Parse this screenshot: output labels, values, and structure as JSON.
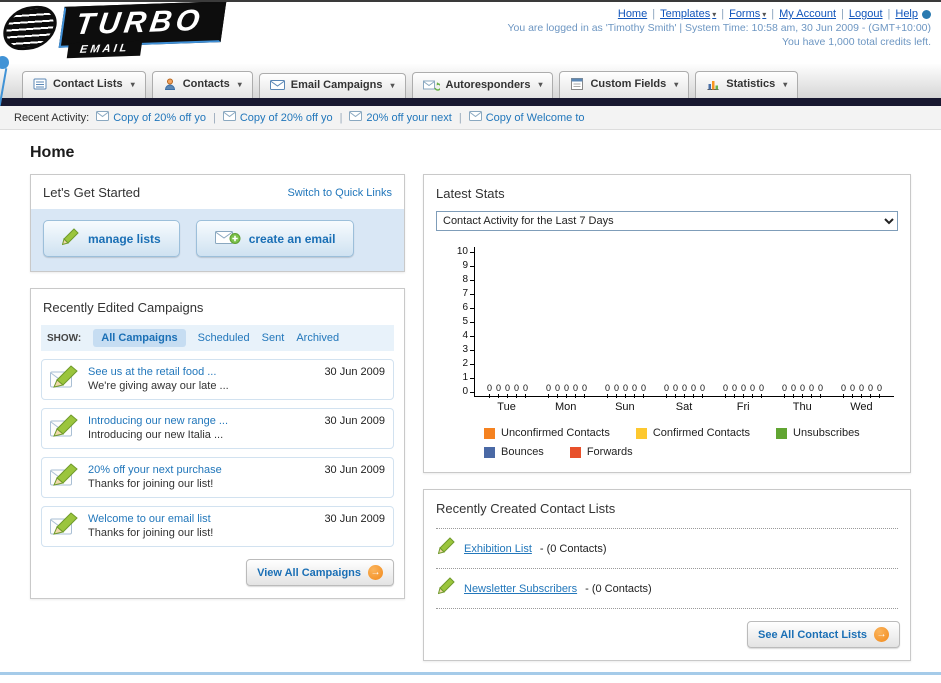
{
  "header": {
    "logo": {
      "title": "TURBO",
      "subtitle": "EMAIL"
    },
    "links": [
      "Home",
      "Templates",
      "Forms",
      "My Account",
      "Logout",
      "Help"
    ],
    "login_info": "You are logged in as 'Timothy Smith' | System Time: 10:58 am, 30 Jun 2009 - (GMT+10:00)",
    "credits": "You have 1,000 total credits left."
  },
  "nav": {
    "tabs": [
      {
        "label": "Contact Lists"
      },
      {
        "label": "Contacts"
      },
      {
        "label": "Email Campaigns"
      },
      {
        "label": "Autoresponders"
      },
      {
        "label": "Custom Fields"
      },
      {
        "label": "Statistics"
      }
    ]
  },
  "recent_activity": {
    "label": "Recent Activity:",
    "items": [
      {
        "label": "Copy of 20% off yo"
      },
      {
        "label": "Copy of 20% off yo"
      },
      {
        "label": "20% off your next"
      },
      {
        "label": "Copy of Welcome to"
      }
    ]
  },
  "page": {
    "title": "Home"
  },
  "get_started": {
    "title": "Let's Get Started",
    "switch_link": "Switch to Quick Links",
    "manage_lists_label": "manage lists",
    "create_email_label": "create an email"
  },
  "campaigns": {
    "title": "Recently Edited Campaigns",
    "show_label": "SHOW:",
    "filters": [
      {
        "label": "All Campaigns",
        "active": true
      },
      {
        "label": "Scheduled",
        "active": false
      },
      {
        "label": "Sent",
        "active": false
      },
      {
        "label": "Archived",
        "active": false
      }
    ],
    "items": [
      {
        "title": "See us at the retail food ...",
        "subtitle": "We're giving away our late ...",
        "date": "30 Jun 2009"
      },
      {
        "title": "Introducing our new range ...",
        "subtitle": "Introducing our new Italia ...",
        "date": "30 Jun 2009"
      },
      {
        "title": "20% off your next purchase",
        "subtitle": "Thanks for joining our list!",
        "date": "30 Jun 2009"
      },
      {
        "title": "Welcome to our email list",
        "subtitle": "Thanks for joining our list!",
        "date": "30 Jun 2009"
      }
    ],
    "view_all_label": "View All Campaigns"
  },
  "stats": {
    "title": "Latest Stats",
    "selected_option": "Contact Activity for the Last 7 Days",
    "chart_data": {
      "type": "bar",
      "title": "Contact Activity for the Last 7 Days",
      "categories": [
        "Tue",
        "Mon",
        "Sun",
        "Sat",
        "Fri",
        "Thu",
        "Wed"
      ],
      "series": [
        {
          "name": "Unconfirmed Contacts",
          "values": [
            0,
            0,
            0,
            0,
            0,
            0,
            0
          ]
        },
        {
          "name": "Confirmed Contacts",
          "values": [
            0,
            0,
            0,
            0,
            0,
            0,
            0
          ]
        },
        {
          "name": "Unsubscribes",
          "values": [
            0,
            0,
            0,
            0,
            0,
            0,
            0
          ]
        },
        {
          "name": "Bounces",
          "values": [
            0,
            0,
            0,
            0,
            0,
            0,
            0
          ]
        },
        {
          "name": "Forwards",
          "values": [
            0,
            0,
            0,
            0,
            0,
            0,
            0
          ]
        }
      ],
      "ylim": [
        0,
        10
      ],
      "grid": false,
      "legend_position": "bottom"
    },
    "legend": [
      {
        "label": "Unconfirmed Contacts",
        "color": "#f58220"
      },
      {
        "label": "Confirmed Contacts",
        "color": "#fdc82f"
      },
      {
        "label": "Unsubscribes",
        "color": "#61a532"
      },
      {
        "label": "Bounces",
        "color": "#4a69a5"
      },
      {
        "label": "Forwards",
        "color": "#e8502a"
      }
    ]
  },
  "contact_lists": {
    "title": "Recently Created Contact Lists",
    "items": [
      {
        "name": "Exhibition List",
        "suffix": "- (0 Contacts)"
      },
      {
        "name": "Newsletter Subscribers",
        "suffix": "- (0 Contacts)"
      }
    ],
    "see_all_label": "See All Contact Lists"
  },
  "colors": {
    "accent_orange": "#f28a1c",
    "link_blue": "#2277bb",
    "dark_bar": "#181830"
  }
}
